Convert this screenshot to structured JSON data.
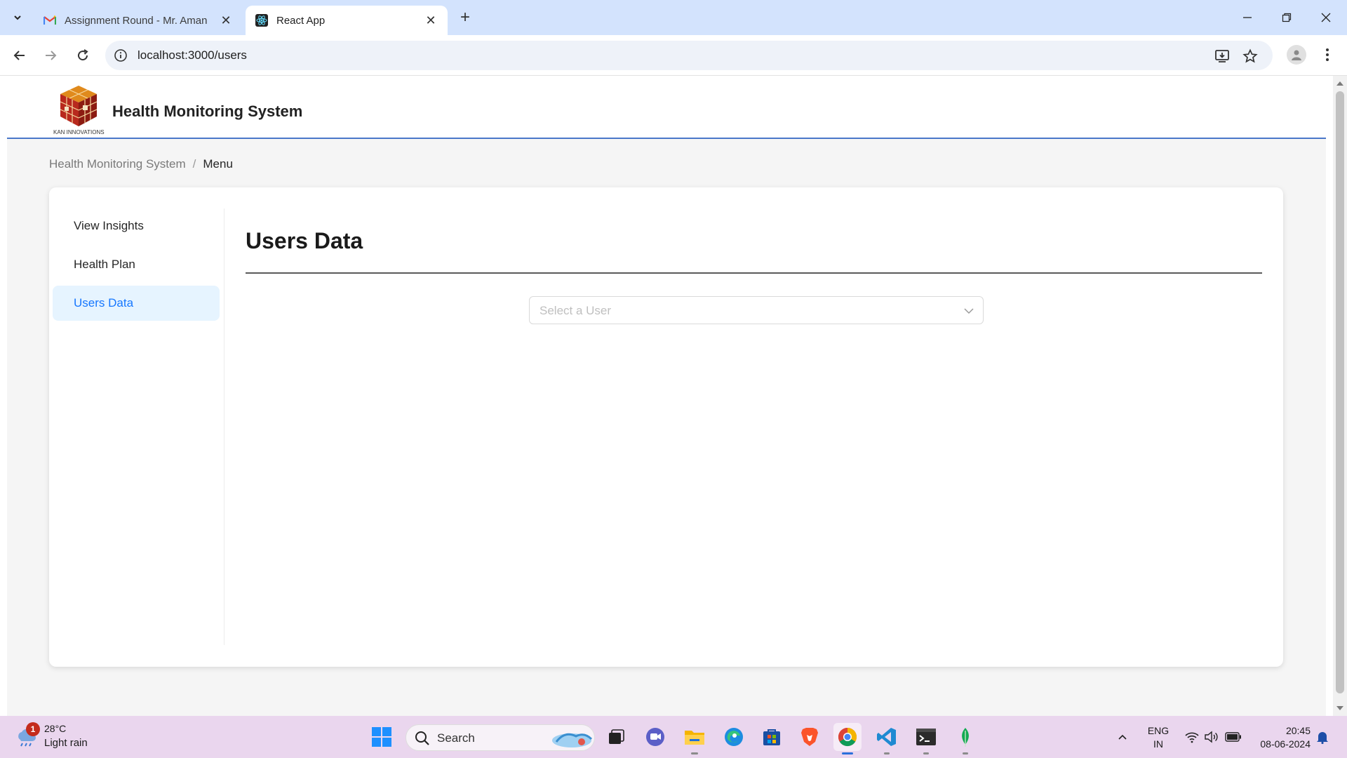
{
  "browser": {
    "tabs": [
      {
        "title": "Assignment Round - Mr. Aman",
        "favicon": "gmail-icon",
        "active": false
      },
      {
        "title": "React App",
        "favicon": "react-icon",
        "active": true
      }
    ],
    "url": "localhost:3000/users"
  },
  "app": {
    "title": "Health Monitoring System",
    "logo_caption": "KAN INNOVATIONS"
  },
  "breadcrumb": {
    "root": "Health Monitoring System",
    "separator": "/",
    "current": "Menu"
  },
  "sidebar": {
    "items": [
      {
        "label": "View Insights",
        "selected": false
      },
      {
        "label": "Health Plan",
        "selected": false
      },
      {
        "label": "Users Data",
        "selected": true
      }
    ]
  },
  "main": {
    "heading": "Users Data",
    "select_placeholder": "Select a User"
  },
  "taskbar": {
    "weather": {
      "temp": "28°C",
      "condition": "Light rain",
      "badge": "1"
    },
    "search_label": "Search",
    "apps": [
      "windows-start-icon",
      "task-view-icon",
      "chat-icon",
      "file-explorer-icon",
      "edge-icon",
      "store-icon",
      "brave-icon",
      "chrome-icon",
      "vscode-icon",
      "terminal-icon",
      "mongodb-compass-icon"
    ],
    "language": {
      "line1": "ENG",
      "line2": "IN"
    },
    "time": "20:45",
    "date": "08-06-2024"
  },
  "colors": {
    "accent": "#1677ff",
    "selected_bg": "#e6f4ff",
    "header_rule": "#4a77c9",
    "tabstrip": "#d3e3fd",
    "taskbar": "#ead6ee"
  }
}
